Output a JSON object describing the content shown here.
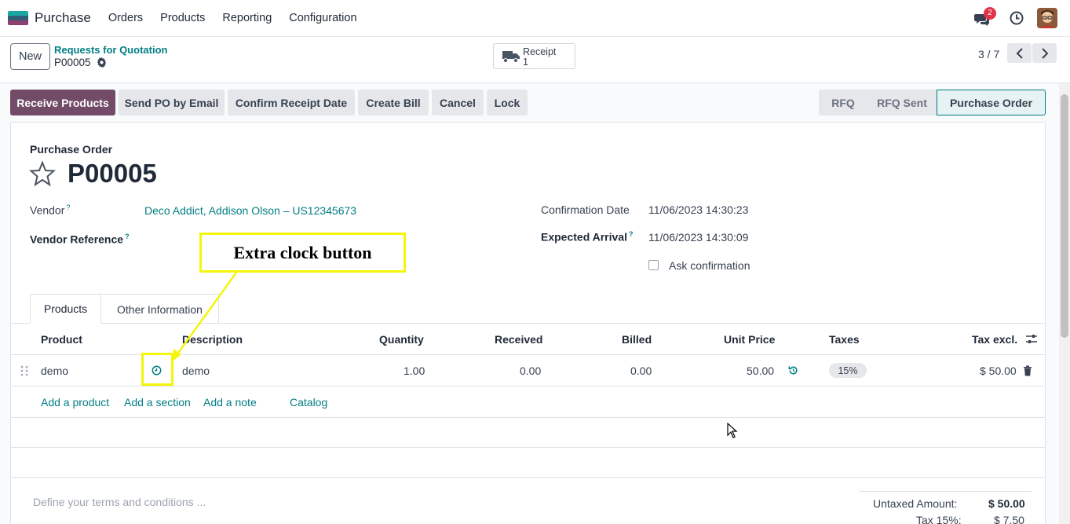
{
  "navbar": {
    "app_name": "Purchase",
    "menu": [
      "Orders",
      "Products",
      "Reporting",
      "Configuration"
    ],
    "chat_count": "2"
  },
  "control_panel": {
    "new_label": "New",
    "breadcrumb_parent": "Requests for Quotation",
    "breadcrumb_current": "P00005",
    "smart_button": {
      "label": "Receipt",
      "value": "1"
    },
    "pager": "3 / 7"
  },
  "actions": {
    "receive": "Receive Products",
    "send_po": "Send PO by Email",
    "confirm_receipt": "Confirm Receipt Date",
    "create_bill": "Create Bill",
    "cancel": "Cancel",
    "lock": "Lock"
  },
  "statusbar": [
    "RFQ",
    "RFQ Sent",
    "Purchase Order"
  ],
  "form": {
    "doc_type": "Purchase Order",
    "name": "P00005",
    "vendor_label": "Vendor",
    "vendor_value": "Deco Addict, Addison Olson – US12345673",
    "vendor_ref_label": "Vendor Reference",
    "confirmation_label": "Confirmation Date",
    "confirmation_value": "11/06/2023 14:30:23",
    "expected_label": "Expected Arrival",
    "expected_value": "11/06/2023 14:30:09",
    "ask_confirmation": "Ask confirmation",
    "help_mark": "?"
  },
  "tabs": [
    "Products",
    "Other Information"
  ],
  "table": {
    "headers": {
      "product": "Product",
      "description": "Description",
      "quantity": "Quantity",
      "received": "Received",
      "billed": "Billed",
      "unit_price": "Unit Price",
      "taxes": "Taxes",
      "tax_excl": "Tax excl."
    },
    "row": {
      "product": "demo",
      "description": "demo",
      "quantity": "1.00",
      "received": "0.00",
      "billed": "0.00",
      "unit_price": "50.00",
      "tax": "15%",
      "subtotal": "$ 50.00"
    },
    "add_links": [
      "Add a product",
      "Add a section",
      "Add a note",
      "Catalog"
    ]
  },
  "annotation": "Extra clock button",
  "terms_placeholder": "Define your terms and conditions ...",
  "totals": {
    "untaxed_label": "Untaxed Amount:",
    "untaxed_value": "$ 50.00",
    "tax_label": "Tax 15%:",
    "tax_value": "$ 7.50"
  },
  "colors": {
    "primary": "#714b67",
    "link": "#017e84",
    "annotation": "#f5f50a"
  }
}
